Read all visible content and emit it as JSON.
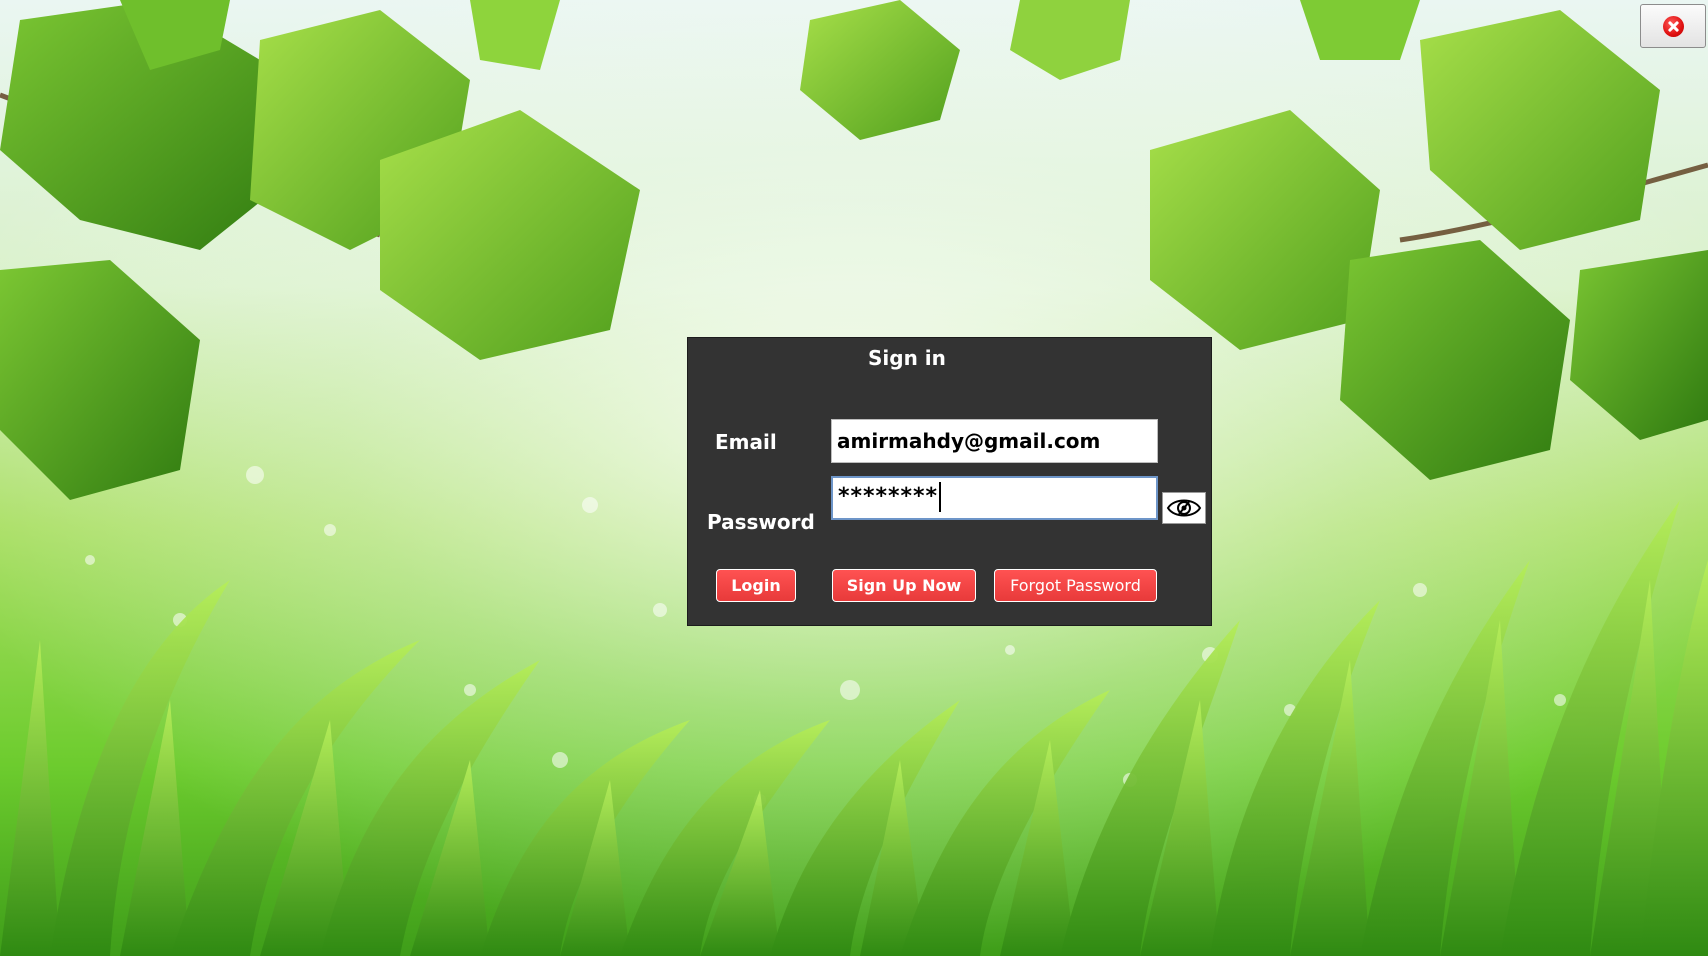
{
  "window": {
    "close_icon": "close-icon",
    "background_scene": "green-leaves-and-grass"
  },
  "login_form": {
    "title": "Sign in",
    "email_label": "Email",
    "email_value": "amirmahdy@gmail.com",
    "password_label": "Password",
    "password_masked_value": "********",
    "show_password_icon": "eye-icon",
    "buttons": {
      "login": "Login",
      "sign_up": "Sign Up Now",
      "forgot_password": "Forgot Password"
    }
  },
  "colors": {
    "panel_background": "#333333",
    "button_red": "#f24545",
    "close_red": "#e01010",
    "field_focus_border": "#6d95c8"
  }
}
